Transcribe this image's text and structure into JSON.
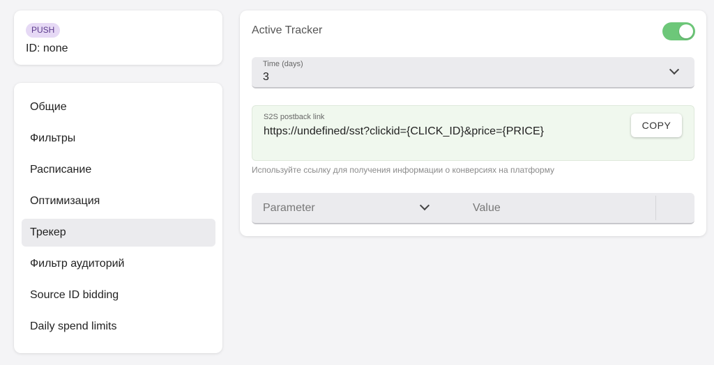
{
  "campaign": {
    "badge": "PUSH",
    "id_text": "ID: none"
  },
  "nav": {
    "items": [
      {
        "label": "Общие"
      },
      {
        "label": "Фильтры"
      },
      {
        "label": "Расписание"
      },
      {
        "label": "Оптимизация"
      },
      {
        "label": "Трекер",
        "active": true
      },
      {
        "label": "Фильтр аудиторий"
      },
      {
        "label": "Source ID bidding"
      },
      {
        "label": "Daily spend limits"
      }
    ]
  },
  "tracker": {
    "title": "Active Tracker",
    "active": true,
    "time": {
      "label": "Time (days)",
      "value": "3"
    },
    "postback": {
      "label": "S2S postback link",
      "link": "https://undefined/sst?clickid={CLICK_ID}&price={PRICE}",
      "copy_label": "COPY"
    },
    "helper_text": "Используйте ссылку для получения информации о конверсиях на платформу",
    "param": {
      "placeholder": "Parameter",
      "value_placeholder": "Value"
    }
  },
  "colors": {
    "accent_toggle": "#6dc779",
    "badge_bg": "#e6d9f5",
    "postback_bg": "#f0f8ee"
  }
}
